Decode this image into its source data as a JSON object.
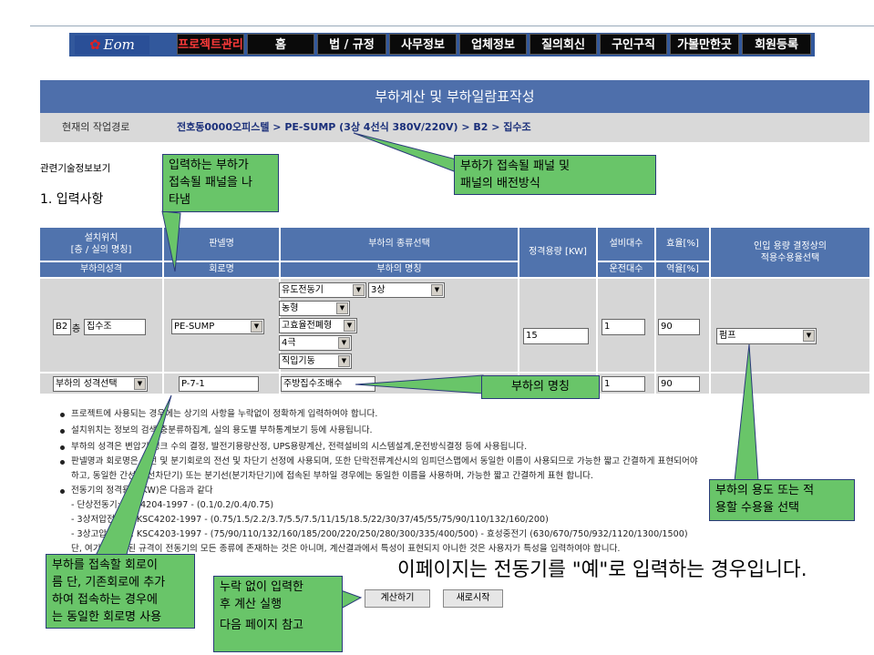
{
  "nav": {
    "logo": "Eom",
    "items": [
      "프로젝트관리",
      "홈",
      "법 / 규정",
      "사무정보",
      "업체정보",
      "질의회신",
      "구인구직",
      "가볼만한곳",
      "회원등록"
    ]
  },
  "header": {
    "title": "부하계산 및 부하일람표작성",
    "path_label": "현재의 작업경로",
    "path_value": "전호동0000오피스텔 > PE-SUMP (3상 4선식 380V/220V) > B2 > 집수조"
  },
  "related_link": "관련기술정보보기",
  "section_title": "1. 입력사항",
  "table": {
    "headers_top": {
      "location": "설치위치\n[층 / 실의 명칭]",
      "panel": "판넬명",
      "load_type": "부하의 종류선택",
      "capacity": "정격용량 [KW]",
      "equip_count": "설비대수",
      "efficiency": "효율[%]",
      "demand": "인입 용량 결정상의\n적용수용율선택"
    },
    "headers_bottom": {
      "location": "부하의성격",
      "panel": "회로명",
      "load_type": "부하의 명칭",
      "run_count": "운전대수",
      "power_factor": "역율[%]"
    },
    "row": {
      "floor": "B2",
      "floor_unit": "층",
      "room": "집수조",
      "panel": "PE-SUMP",
      "motor_type": "유도전동기",
      "phase": "3상",
      "motor_kind": "농형",
      "start_method": "고효율전폐형",
      "poles": "4극",
      "drive": "직입기동",
      "capacity": "15",
      "equip_count": "1",
      "efficiency": "90",
      "demand": "펌프",
      "load_character": "부하의 성격선택",
      "circuit": "P-7-1",
      "load_name": "주방집수조배수",
      "run_count": "1",
      "power_factor": "90"
    }
  },
  "notes": [
    "프로젝트에 사용되는 경우에는 상기의 사항을 누락없이 정확하게 입력하여야 합니다.",
    "설치위치는 정보의 검색,충분류하집계, 실의 용도별 부하통계보기 등에 사용됩니다.",
    "부하의 성격은 변압기 뱅크 수의 결정, 발전기용량산정, UPS용량계산, 전력설비의 시스템설계,운전방식결정 등에 사용됩니다.",
    "판넬명과 회로명은 간선 및 분기회로의 전선 및 차단기 선정에 사용되며, 또한 단락전류계산시의 임피던스맵에서 동일한 이름이 사용되므로 가능한 짧고 간결하게 표현되어야",
    "하고, 동일한 간선(간선차단기) 또는 분기선(분기차단기)에 접속된 부하일 경우에는 동일한 이름을 사용하며, 가능한 짧고 간결하게 표현 합니다.",
    "전동기의 정격용량(KW)은 다음과 같다",
    "- 단상전동기: KSC4204-1997 - (0.1/0.2/0.4/0.75)",
    "- 3상저압전동기: KSC4202-1997 - (0.75/1.5/2.2/3.7/5.5/7.5/11/15/18.5/22/30/37/45/55/75/90/110/132/160/200)",
    "- 3상고압전동기: KSC4203-1997 - (75/90/110/132/160/185/200/220/250/280/300/335/400/500) - 효성중전기 (630/670/750/932/1120/1300/1500)",
    "단, 여기에 표현된 규격이 전동기의 모든 종류에 존재하는 것은 아니며, 계산결과에서 특성이 표현되지 아니한 것은 사용자가 특성을 입력하여야 합니다."
  ],
  "buttons": {
    "calculate": "계산하기",
    "restart": "새로시작"
  },
  "callouts": {
    "panel_input": "입력하는 부하가\n접속될 패널을 나\n타냄",
    "panel_wiring": "부하가 접속될 패널 및\n패널의 배전방식",
    "load_name": "부하의 명칭",
    "demand_usage": "부하의 용도 또는 적\n용할 수용율 선택",
    "circuit_note": "부하를 접속할 회로이\n름 단, 기존회로에 추가\n하여 접속하는 경우에\n는 동일한 회로명 사용",
    "calc_note_1": "누락 없이 입력한\n후 계산 실행",
    "calc_note_2": "다음 페이지 참고"
  },
  "example_caption": "이페이지는 전동기를 \"예\"로 입력하는 경우입니다.",
  "colors": {
    "nav": "#32589c",
    "title_bar": "#4e6fab",
    "table_header": "#5073ad",
    "callout": "#69c569"
  }
}
